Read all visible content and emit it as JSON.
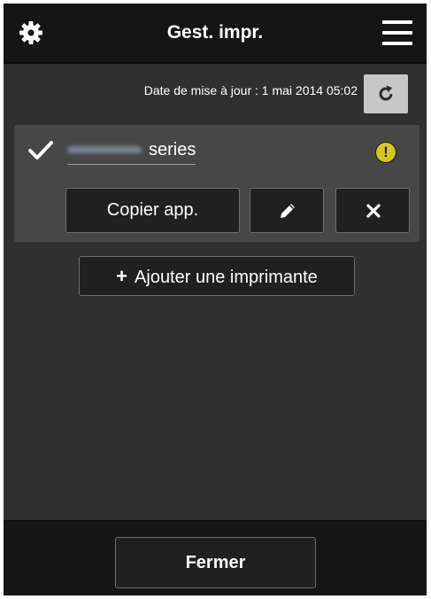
{
  "header": {
    "title": "Gest. impr.",
    "settings_icon": "gear-icon",
    "menu_icon": "hamburger-menu-icon"
  },
  "update": {
    "text": "Date de mise à jour : 1 mai 2014 05:02",
    "refresh_icon": "refresh-icon"
  },
  "printers": [
    {
      "selected": true,
      "name_suffix": "series",
      "name_prefix_redacted": true,
      "status_icon": "warning-icon",
      "status_symbol": "!",
      "copy_label": "Copier app.",
      "edit_icon": "pencil-icon",
      "delete_icon": "close-icon"
    }
  ],
  "actions": {
    "add_printer_label": "Ajouter une imprimante",
    "add_printer_symbol": "+",
    "close_label": "Fermer"
  },
  "colors": {
    "background": "#303030",
    "header": "#151515",
    "card": "#474747",
    "button": "#202020",
    "warning": "#d5c81c",
    "refresh_button": "#c7c7c7"
  }
}
